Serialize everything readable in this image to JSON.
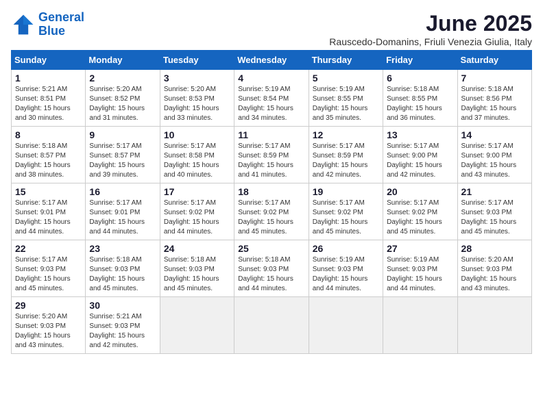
{
  "logo": {
    "line1": "General",
    "line2": "Blue"
  },
  "title": "June 2025",
  "location": "Rauscedo-Domanins, Friuli Venezia Giulia, Italy",
  "days_of_week": [
    "Sunday",
    "Monday",
    "Tuesday",
    "Wednesday",
    "Thursday",
    "Friday",
    "Saturday"
  ],
  "weeks": [
    [
      {
        "day": "1",
        "info": "Sunrise: 5:21 AM\nSunset: 8:51 PM\nDaylight: 15 hours\nand 30 minutes."
      },
      {
        "day": "2",
        "info": "Sunrise: 5:20 AM\nSunset: 8:52 PM\nDaylight: 15 hours\nand 31 minutes."
      },
      {
        "day": "3",
        "info": "Sunrise: 5:20 AM\nSunset: 8:53 PM\nDaylight: 15 hours\nand 33 minutes."
      },
      {
        "day": "4",
        "info": "Sunrise: 5:19 AM\nSunset: 8:54 PM\nDaylight: 15 hours\nand 34 minutes."
      },
      {
        "day": "5",
        "info": "Sunrise: 5:19 AM\nSunset: 8:55 PM\nDaylight: 15 hours\nand 35 minutes."
      },
      {
        "day": "6",
        "info": "Sunrise: 5:18 AM\nSunset: 8:55 PM\nDaylight: 15 hours\nand 36 minutes."
      },
      {
        "day": "7",
        "info": "Sunrise: 5:18 AM\nSunset: 8:56 PM\nDaylight: 15 hours\nand 37 minutes."
      }
    ],
    [
      {
        "day": "8",
        "info": "Sunrise: 5:18 AM\nSunset: 8:57 PM\nDaylight: 15 hours\nand 38 minutes."
      },
      {
        "day": "9",
        "info": "Sunrise: 5:17 AM\nSunset: 8:57 PM\nDaylight: 15 hours\nand 39 minutes."
      },
      {
        "day": "10",
        "info": "Sunrise: 5:17 AM\nSunset: 8:58 PM\nDaylight: 15 hours\nand 40 minutes."
      },
      {
        "day": "11",
        "info": "Sunrise: 5:17 AM\nSunset: 8:59 PM\nDaylight: 15 hours\nand 41 minutes."
      },
      {
        "day": "12",
        "info": "Sunrise: 5:17 AM\nSunset: 8:59 PM\nDaylight: 15 hours\nand 42 minutes."
      },
      {
        "day": "13",
        "info": "Sunrise: 5:17 AM\nSunset: 9:00 PM\nDaylight: 15 hours\nand 42 minutes."
      },
      {
        "day": "14",
        "info": "Sunrise: 5:17 AM\nSunset: 9:00 PM\nDaylight: 15 hours\nand 43 minutes."
      }
    ],
    [
      {
        "day": "15",
        "info": "Sunrise: 5:17 AM\nSunset: 9:01 PM\nDaylight: 15 hours\nand 44 minutes."
      },
      {
        "day": "16",
        "info": "Sunrise: 5:17 AM\nSunset: 9:01 PM\nDaylight: 15 hours\nand 44 minutes."
      },
      {
        "day": "17",
        "info": "Sunrise: 5:17 AM\nSunset: 9:02 PM\nDaylight: 15 hours\nand 44 minutes."
      },
      {
        "day": "18",
        "info": "Sunrise: 5:17 AM\nSunset: 9:02 PM\nDaylight: 15 hours\nand 45 minutes."
      },
      {
        "day": "19",
        "info": "Sunrise: 5:17 AM\nSunset: 9:02 PM\nDaylight: 15 hours\nand 45 minutes."
      },
      {
        "day": "20",
        "info": "Sunrise: 5:17 AM\nSunset: 9:02 PM\nDaylight: 15 hours\nand 45 minutes."
      },
      {
        "day": "21",
        "info": "Sunrise: 5:17 AM\nSunset: 9:03 PM\nDaylight: 15 hours\nand 45 minutes."
      }
    ],
    [
      {
        "day": "22",
        "info": "Sunrise: 5:17 AM\nSunset: 9:03 PM\nDaylight: 15 hours\nand 45 minutes."
      },
      {
        "day": "23",
        "info": "Sunrise: 5:18 AM\nSunset: 9:03 PM\nDaylight: 15 hours\nand 45 minutes."
      },
      {
        "day": "24",
        "info": "Sunrise: 5:18 AM\nSunset: 9:03 PM\nDaylight: 15 hours\nand 45 minutes."
      },
      {
        "day": "25",
        "info": "Sunrise: 5:18 AM\nSunset: 9:03 PM\nDaylight: 15 hours\nand 44 minutes."
      },
      {
        "day": "26",
        "info": "Sunrise: 5:19 AM\nSunset: 9:03 PM\nDaylight: 15 hours\nand 44 minutes."
      },
      {
        "day": "27",
        "info": "Sunrise: 5:19 AM\nSunset: 9:03 PM\nDaylight: 15 hours\nand 44 minutes."
      },
      {
        "day": "28",
        "info": "Sunrise: 5:20 AM\nSunset: 9:03 PM\nDaylight: 15 hours\nand 43 minutes."
      }
    ],
    [
      {
        "day": "29",
        "info": "Sunrise: 5:20 AM\nSunset: 9:03 PM\nDaylight: 15 hours\nand 43 minutes."
      },
      {
        "day": "30",
        "info": "Sunrise: 5:21 AM\nSunset: 9:03 PM\nDaylight: 15 hours\nand 42 minutes."
      },
      {
        "day": "",
        "info": ""
      },
      {
        "day": "",
        "info": ""
      },
      {
        "day": "",
        "info": ""
      },
      {
        "day": "",
        "info": ""
      },
      {
        "day": "",
        "info": ""
      }
    ]
  ]
}
